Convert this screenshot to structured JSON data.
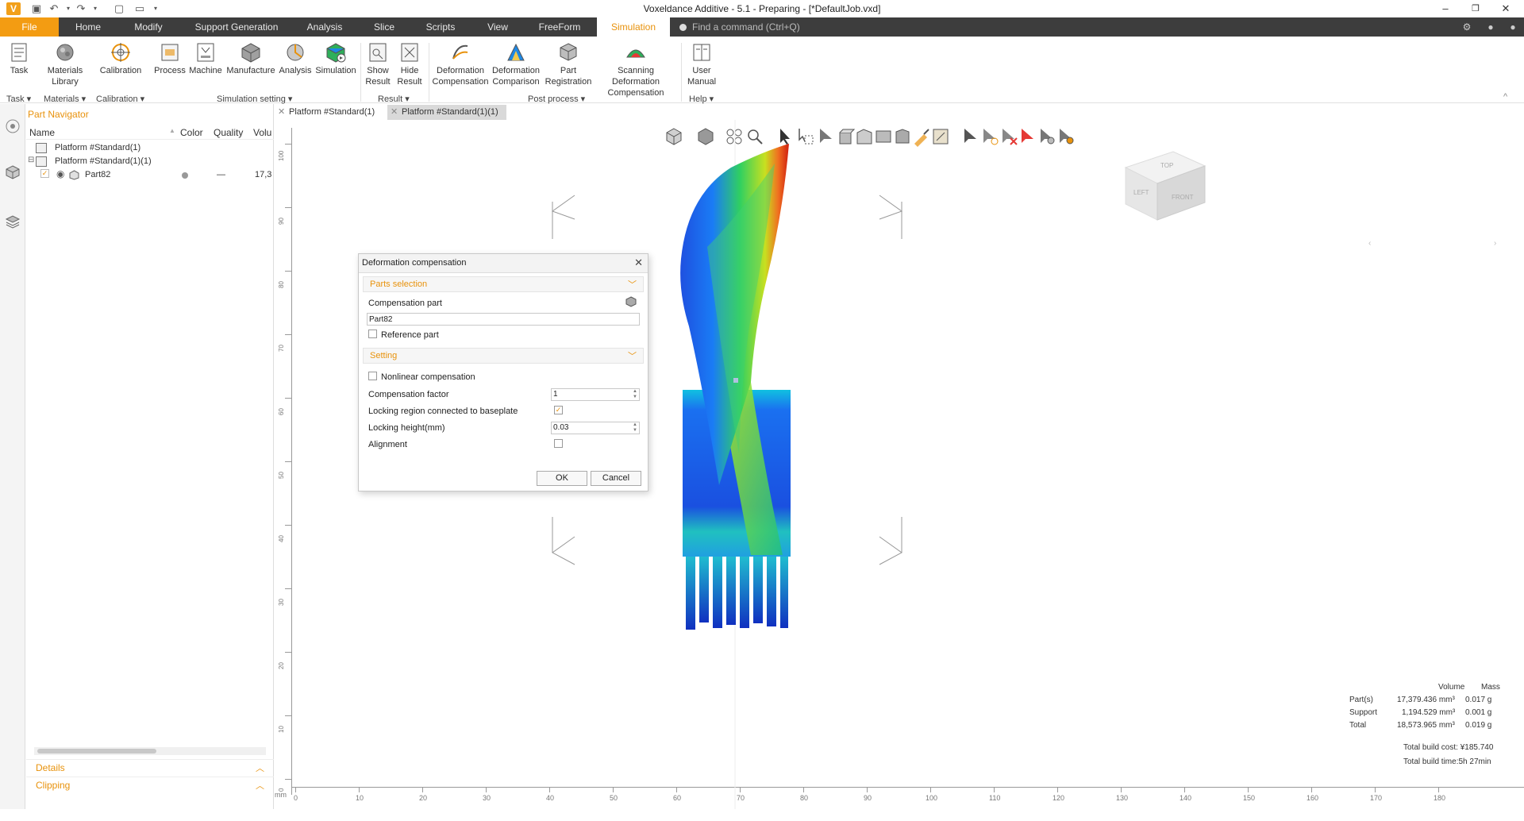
{
  "window": {
    "title": "Voxeldance Additive - 5.1 - Preparing - [*DefaultJob.vxd]"
  },
  "menu": {
    "tabs": [
      "File",
      "Home",
      "Modify",
      "Support Generation",
      "Analysis",
      "Slice",
      "Scripts",
      "View",
      "FreeForm",
      "Simulation"
    ],
    "search_placeholder": "Find a command (Ctrl+Q)"
  },
  "ribbon": {
    "buttons": [
      {
        "l1": "Task",
        "l2": ""
      },
      {
        "l1": "Materials",
        "l2": "Library"
      },
      {
        "l1": "Calibration",
        "l2": ""
      },
      {
        "l1": "Process",
        "l2": ""
      },
      {
        "l1": "Machine",
        "l2": ""
      },
      {
        "l1": "Manufacture",
        "l2": ""
      },
      {
        "l1": "Analysis",
        "l2": ""
      },
      {
        "l1": "Simulation",
        "l2": ""
      },
      {
        "l1": "Show",
        "l2": "Result"
      },
      {
        "l1": "Hide",
        "l2": "Result"
      },
      {
        "l1": "Deformation",
        "l2": "Compensation"
      },
      {
        "l1": "Deformation",
        "l2": "Comparison"
      },
      {
        "l1": "Part",
        "l2": "Registration"
      },
      {
        "l1": "Scanning Deformation",
        "l2": "Compensation"
      },
      {
        "l1": "User",
        "l2": "Manual"
      }
    ],
    "groups": [
      "Task",
      "Materials",
      "Calibration",
      "Simulation setting",
      "Result",
      "Post process",
      "Help"
    ]
  },
  "navigator": {
    "title": "Part Navigator",
    "columns": [
      "Name",
      "Color",
      "Quality",
      "Volu"
    ],
    "rows": [
      {
        "name": "Platform #Standard(1)"
      },
      {
        "name": "Platform #Standard(1)(1)"
      },
      {
        "name": "Part82",
        "quality": "—",
        "volume": "17,3"
      }
    ],
    "sections": [
      "Details",
      "Clipping"
    ]
  },
  "doc_tabs": [
    "Platform #Standard(1)",
    "Platform #Standard(1)(1)"
  ],
  "dialog": {
    "title": "Deformation compensation",
    "section_parts": "Parts selection",
    "compensation_part_label": "Compensation part",
    "compensation_part_value": "Part82",
    "reference_part_label": "Reference part",
    "section_setting": "Setting",
    "nonlinear_label": "Nonlinear compensation",
    "factor_label": "Compensation factor",
    "factor_value": "1",
    "locking_region_label": "Locking region connected to baseplate",
    "locking_height_label": "Locking height(mm)",
    "locking_height_value": "0.03",
    "alignment_label": "Alignment",
    "ok": "OK",
    "cancel": "Cancel",
    "checks": {
      "reference_part": false,
      "nonlinear": false,
      "locking_region": true,
      "alignment": false
    }
  },
  "viewcube": {
    "top": "TOP",
    "left": "LEFT",
    "front": "FRONT"
  },
  "rulers": {
    "vertical": [
      "100",
      "90",
      "80",
      "70",
      "60",
      "50",
      "40",
      "30",
      "20",
      "10",
      "0"
    ],
    "horizontal_unit": "mm",
    "horizontal": [
      "0",
      "10",
      "20",
      "30",
      "40",
      "50",
      "60",
      "70",
      "80",
      "90",
      "100",
      "110",
      "120",
      "130",
      "140",
      "150",
      "160",
      "170",
      "180"
    ]
  },
  "stats": {
    "col_volume": "Volume",
    "col_mass": "Mass",
    "rows": [
      {
        "label": "Part(s)",
        "volume": "17,379.436 mm³",
        "mass": "0.017 g"
      },
      {
        "label": "Support",
        "volume": "1,194.529 mm³",
        "mass": "0.001 g"
      },
      {
        "label": "Total",
        "volume": "18,573.965 mm³",
        "mass": "0.019 g"
      }
    ],
    "build_cost": "Total build cost: ¥185.740",
    "build_time": "Total build time:5h 27min"
  },
  "colors": {
    "accent": "#f39c12",
    "menubar": "#3d3d3d",
    "section_text": "#e8920c"
  }
}
